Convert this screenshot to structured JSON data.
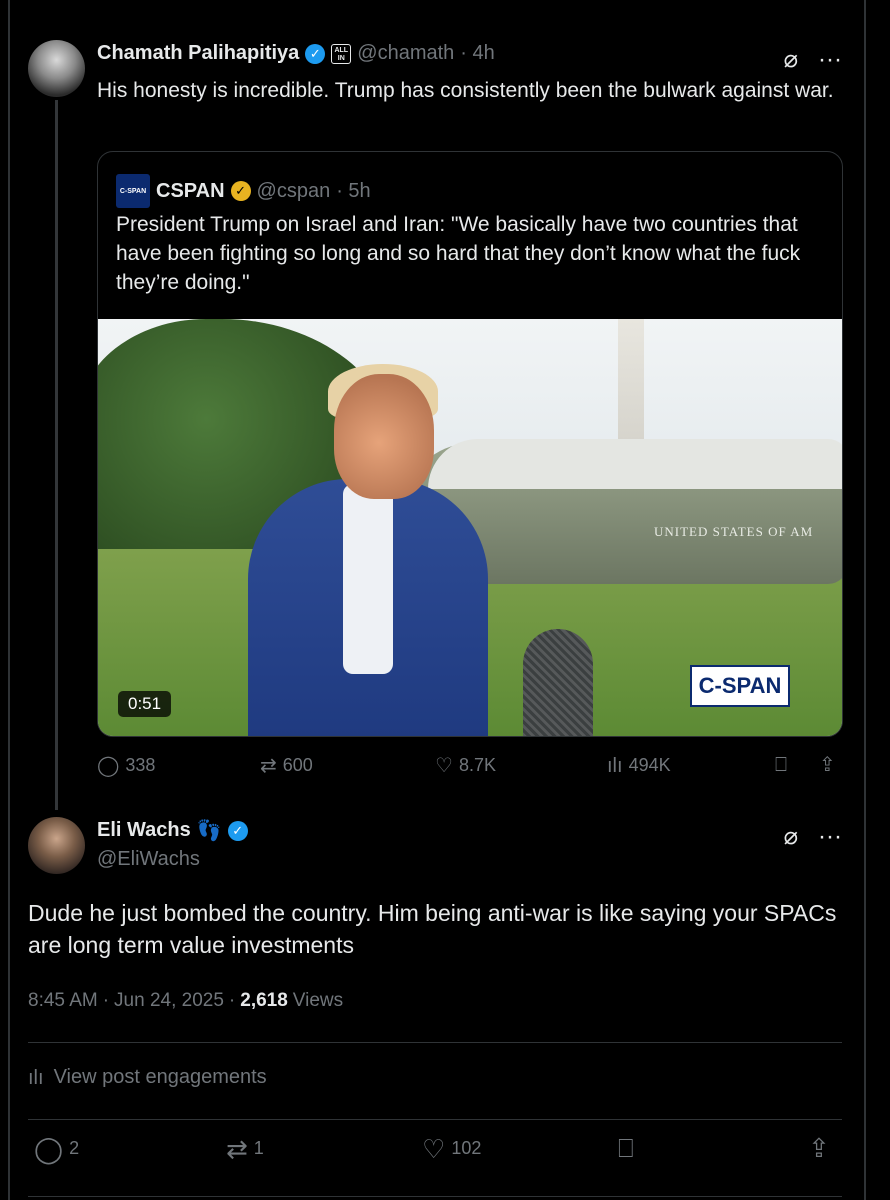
{
  "accent": "#1d9bf0",
  "background": "#000000",
  "parent_post": {
    "author_name": "Chamath Palihapitiya",
    "handle": "@chamath",
    "time": "· 4h",
    "badge_icon": "all-in-badge",
    "text": "His honesty is incredible. Trump has consistently been the bulwark against war.",
    "quoted": {
      "author_name": "CSPAN",
      "logo_text": "C-SPAN",
      "handle": "@cspan",
      "time": "· 5h",
      "text": "President Trump on Israel and Iran: \"We basically have two countries that have been fighting so long and so hard that they don’t know what the fuck they’re doing.\"",
      "video_duration": "0:51",
      "video_bug": "C-SPAN",
      "helicopter_text": "UNITED STATES OF AM"
    },
    "stats": {
      "replies": "338",
      "reposts": "600",
      "likes": "8.7K",
      "views": "494K"
    }
  },
  "main_post": {
    "author_name": "Eli Wachs",
    "name_emoji": "👣",
    "handle": "@EliWachs",
    "text": "Dude he just bombed the country. Him being anti-war is like saying your SPACs are long term value investments",
    "time": "8:45 AM",
    "date": "Jun 24, 2025",
    "views_count": "2,618",
    "views_label": "Views",
    "engagements_label": "View post engagements",
    "stats": {
      "replies": "2",
      "reposts": "1",
      "likes": "102"
    }
  }
}
